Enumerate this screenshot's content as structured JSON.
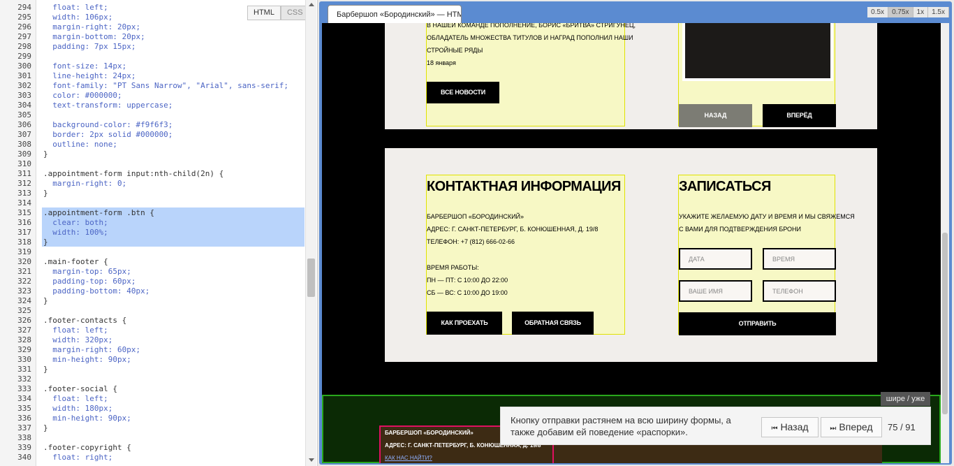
{
  "editor": {
    "modes": [
      "HTML",
      "CSS"
    ],
    "lines": [
      {
        "n": "294",
        "t": "  float: left;"
      },
      {
        "n": "295",
        "t": "  width: 106px;"
      },
      {
        "n": "296",
        "t": "  margin-right: 20px;"
      },
      {
        "n": "297",
        "t": "  margin-bottom: 20px;"
      },
      {
        "n": "298",
        "t": "  padding: 7px 15px;"
      },
      {
        "n": "299",
        "t": ""
      },
      {
        "n": "300",
        "t": "  font-size: 14px;"
      },
      {
        "n": "301",
        "t": "  line-height: 24px;"
      },
      {
        "n": "302",
        "t": "  font-family: \"PT Sans Narrow\", \"Arial\", sans-serif;"
      },
      {
        "n": "303",
        "t": "  color: #000000;"
      },
      {
        "n": "304",
        "t": "  text-transform: uppercase;"
      },
      {
        "n": "305",
        "t": ""
      },
      {
        "n": "306",
        "t": "  background-color: #f9f6f3;"
      },
      {
        "n": "307",
        "t": "  border: 2px solid #000000;"
      },
      {
        "n": "308",
        "t": "  outline: none;"
      },
      {
        "n": "309",
        "t": "}"
      },
      {
        "n": "310",
        "t": ""
      },
      {
        "n": "311",
        "t": ".appointment-form input:nth-child(2n) {"
      },
      {
        "n": "312",
        "t": "  margin-right: 0;"
      },
      {
        "n": "313",
        "t": "}"
      },
      {
        "n": "314",
        "t": ""
      },
      {
        "n": "315",
        "t": ".appointment-form .btn {"
      },
      {
        "n": "316",
        "t": "  clear: both;"
      },
      {
        "n": "317",
        "t": "  width: 100%;"
      },
      {
        "n": "318",
        "t": "}"
      },
      {
        "n": "319",
        "t": ""
      },
      {
        "n": "320",
        "t": ".main-footer {"
      },
      {
        "n": "321",
        "t": "  margin-top: 65px;"
      },
      {
        "n": "322",
        "t": "  padding-top: 60px;"
      },
      {
        "n": "323",
        "t": "  padding-bottom: 40px;"
      },
      {
        "n": "324",
        "t": "}"
      },
      {
        "n": "325",
        "t": ""
      },
      {
        "n": "326",
        "t": ".footer-contacts {"
      },
      {
        "n": "327",
        "t": "  float: left;"
      },
      {
        "n": "328",
        "t": "  width: 320px;"
      },
      {
        "n": "329",
        "t": "  margin-right: 60px;"
      },
      {
        "n": "330",
        "t": "  min-height: 90px;"
      },
      {
        "n": "331",
        "t": "}"
      },
      {
        "n": "332",
        "t": ""
      },
      {
        "n": "333",
        "t": ".footer-social {"
      },
      {
        "n": "334",
        "t": "  float: left;"
      },
      {
        "n": "335",
        "t": "  width: 180px;"
      },
      {
        "n": "336",
        "t": "  min-height: 90px;"
      },
      {
        "n": "337",
        "t": "}"
      },
      {
        "n": "338",
        "t": ""
      },
      {
        "n": "339",
        "t": ".footer-copyright {"
      },
      {
        "n": "340",
        "t": "  float: right;"
      }
    ]
  },
  "preview": {
    "tab_title": "Барбершоп «Бородинский» — HTM",
    "zoom_levels": [
      "0.5x",
      "0.75x",
      "1x",
      "1.5x"
    ],
    "news": {
      "text_lines": [
        "В НАШЕЙ КОМАНДЕ ПОПОЛНЕНИЕ, БОРИС «БРИТВА» СТРИГУНЕЦ,",
        "ОБЛАДАТЕЛЬ МНОЖЕСТВА ТИТУЛОВ И НАГРАД ПОПОЛНИЛ НАШИ",
        "СТРОЙНЫЕ РЯДЫ"
      ],
      "date": "18 января",
      "all_news_btn": "ВСЕ НОВОСТИ",
      "prev_btn": "НАЗАД",
      "next_btn": "ВПЕРЁД"
    },
    "contacts": {
      "title": "КОНТАКТНАЯ ИНФОРМАЦИЯ",
      "name": "БАРБЕРШОП «БОРОДИНСКИЙ»",
      "address": "АДРЕС: Г. САНКТ-ПЕТЕРБУРГ, Б. КОНЮШЕННАЯ, Д. 19/8",
      "phone": "ТЕЛЕФОН: +7 (812) 666-02-66",
      "hours_title": "ВРЕМЯ РАБОТЫ:",
      "hours_weekdays": "ПН — ПТ: С 10:00 ДО 22:00",
      "hours_weekend": "СБ — ВС: С 10:00 ДО 19:00",
      "directions_btn": "КАК ПРОЕХАТЬ",
      "feedback_btn": "ОБРАТНАЯ СВЯЗЬ"
    },
    "appointment": {
      "title": "ЗАПИСАТЬСЯ",
      "desc_line1": "УКАЖИТЕ ЖЕЛАЕМУЮ ДАТУ И ВРЕМЯ И МЫ СВЯЖЕМСЯ",
      "desc_line2": "С ВАМИ ДЛЯ ПОДТВЕРЖДЕНИЯ БРОНИ",
      "date_placeholder": "ДАТА",
      "time_placeholder": "ВРЕМЯ",
      "name_placeholder": "ВАШЕ ИМЯ",
      "phone_placeholder": "ТЕЛЕФОН",
      "submit_btn": "ОТПРАВИТЬ"
    },
    "footer": {
      "name": "БАРБЕРШОП «БОРОДИНСКИЙ»",
      "address": "АДРЕС: Г. САНКТ-ПЕТЕРБУРГ, Б. КОНЮШЕННАЯ, Д. 19/8",
      "link": "КАК НАС НАЙТИ?"
    }
  },
  "tour": {
    "text": "Кнопку отправки растянем на всю ширину формы, а также добавим ей поведение «распорки».",
    "back_label": "Назад",
    "next_label": "Вперед",
    "counter": "75 / 91",
    "wider_narrower": "шире / уже"
  }
}
